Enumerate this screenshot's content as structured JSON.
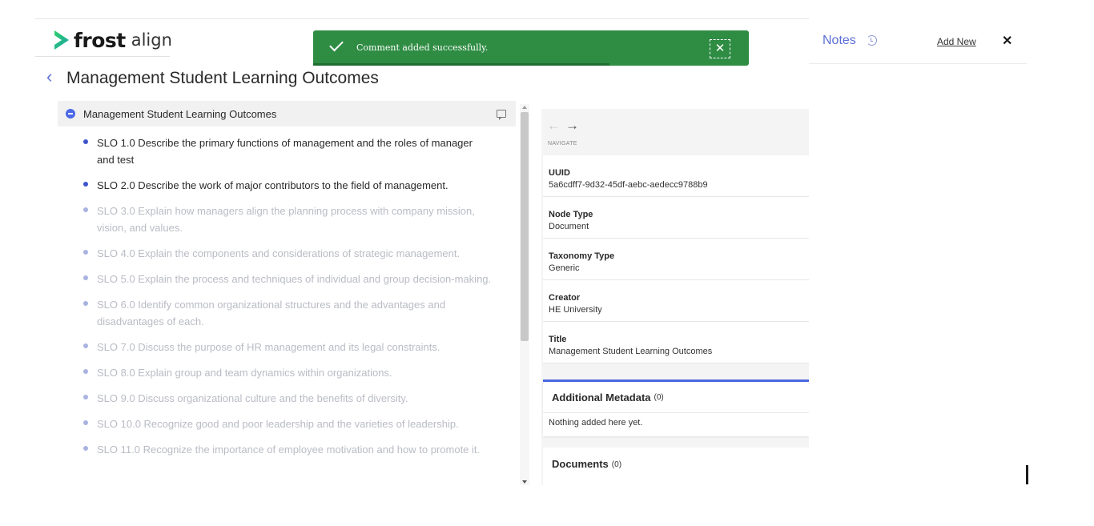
{
  "brand": {
    "name_bold": "frost",
    "name_light": "align"
  },
  "page": {
    "back_icon": "chevron-left-icon",
    "title": "Management Student Learning Outcomes"
  },
  "toast": {
    "message": "Comment added successfully.",
    "close_label": "✕",
    "progress": 0.68,
    "color": "#2e8c43"
  },
  "tree": {
    "root": {
      "label": "Management Student Learning Outcomes"
    },
    "items": [
      {
        "label": "SLO 1.0 Describe the primary functions of management and the roles of manager and test",
        "active": true
      },
      {
        "label": "SLO 2.0 Describe the work of major contributors to the field of management.",
        "active": true
      },
      {
        "label": "SLO 3.0 Explain how managers align the planning process with company mission, vision, and values.",
        "active": false
      },
      {
        "label": "SLO 4.0 Explain the components and considerations of strategic management.",
        "active": false
      },
      {
        "label": "SLO 5.0 Explain the process and techniques of individual and group decision-making.",
        "active": false
      },
      {
        "label": "SLO 6.0 Identify common organizational structures and the advantages and disadvantages of each.",
        "active": false
      },
      {
        "label": "SLO 7.0 Discuss the purpose of HR management and its legal constraints.",
        "active": false
      },
      {
        "label": "SLO 8.0 Explain group and team dynamics within organizations.",
        "active": false
      },
      {
        "label": "SLO 9.0 Discuss organizational culture and the benefits of diversity.",
        "active": false
      },
      {
        "label": "SLO 10.0 Recognize good and poor leadership and the varieties of leadership.",
        "active": false
      },
      {
        "label": "SLO 11.0 Recognize the importance of employee motivation and how to promote it.",
        "active": false
      }
    ]
  },
  "detail": {
    "nav": {
      "back": "←",
      "forward": "→",
      "label": "NAVIGATE"
    },
    "fields": [
      {
        "label": "UUID",
        "value": "5a6cdff7-9d32-45df-aebc-aedecc9788b9"
      },
      {
        "label": "Node Type",
        "value": "Document"
      },
      {
        "label": "Taxonomy Type",
        "value": "Generic"
      },
      {
        "label": "Creator",
        "value": "HE University"
      },
      {
        "label": "Title",
        "value": "Management Student Learning Outcomes"
      }
    ],
    "additional_metadata": {
      "title": "Additional Metadata",
      "count": "(0)",
      "empty": "Nothing added here yet."
    },
    "documents": {
      "title": "Documents",
      "count": "(0)"
    }
  },
  "notes": {
    "title": "Notes",
    "add_new": "Add New",
    "close": "✕"
  },
  "colors": {
    "accent": "#4c68e0",
    "toast": "#2e8c43"
  }
}
